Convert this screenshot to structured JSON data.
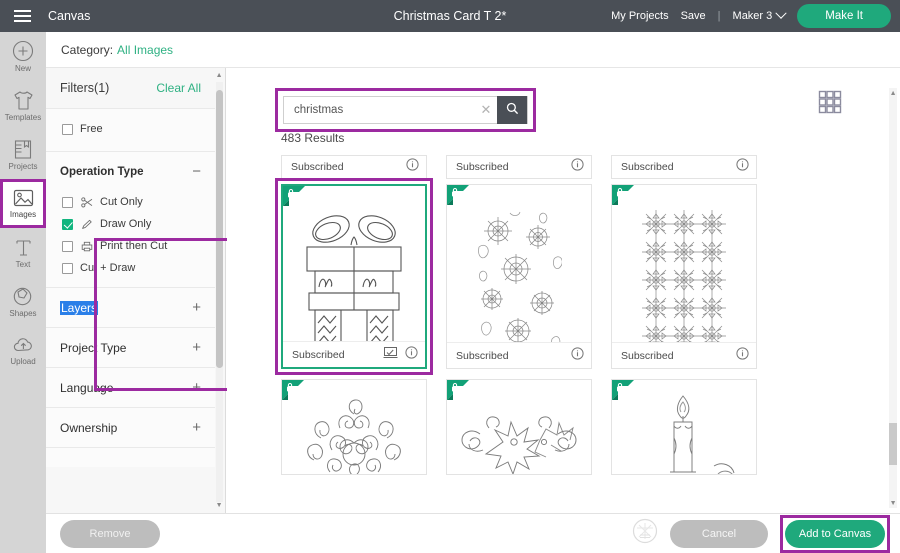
{
  "topbar": {
    "menu_icon": "hamburger-icon",
    "canvas_label": "Canvas",
    "project_title": "Christmas Card T 2*",
    "my_projects_label": "My Projects",
    "save_label": "Save",
    "divider": "|",
    "machine_label": "Maker 3",
    "chevron_icon": "chevron-down-icon",
    "make_it_label": "Make It",
    "bg_color": "#4a4f56",
    "accent_green": "#1fa97c"
  },
  "rail": {
    "items": [
      {
        "label": "New",
        "icon": "plus-circle-icon",
        "selected": false
      },
      {
        "label": "Templates",
        "icon": "tshirt-icon",
        "selected": false
      },
      {
        "label": "Projects",
        "icon": "book-icon",
        "selected": false
      },
      {
        "label": "Images",
        "icon": "image-icon",
        "selected": true
      },
      {
        "label": "Text",
        "icon": "text-icon",
        "selected": false
      },
      {
        "label": "Shapes",
        "icon": "shapes-icon",
        "selected": false
      },
      {
        "label": "Upload",
        "icon": "upload-cloud-icon",
        "selected": false
      }
    ]
  },
  "category_bar": {
    "label": "Category:",
    "value": "All Images"
  },
  "filters": {
    "title": "Filters(1)",
    "clear_all": "Clear All",
    "free_option": {
      "label": "Free",
      "checked": false
    },
    "operation_type": {
      "title": "Operation Type",
      "toggle": "−",
      "expanded": true,
      "highlighted": true,
      "options": [
        {
          "label": "Cut Only",
          "checked": false,
          "icon": "scissors-icon"
        },
        {
          "label": "Draw Only",
          "checked": true,
          "icon": "pen-icon"
        },
        {
          "label": "Print then Cut",
          "checked": false,
          "icon": "printer-icon"
        },
        {
          "label": "Cut + Draw",
          "checked": false,
          "icon": "none"
        }
      ]
    },
    "sections": [
      {
        "title": "Layers",
        "toggle": "+",
        "text_selected": true
      },
      {
        "title": "Project Type",
        "toggle": "+",
        "text_selected": false
      },
      {
        "title": "Language",
        "toggle": "+",
        "text_selected": false
      },
      {
        "title": "Ownership",
        "toggle": "+",
        "text_selected": false
      }
    ]
  },
  "search": {
    "value": "christmas",
    "placeholder": "Search",
    "clear_icon": "close-icon",
    "search_icon": "search-icon",
    "highlighted": true
  },
  "results": {
    "count_label": "483 Results",
    "grid_toggle_icon": "grid-view-icon",
    "cards": [
      {
        "top_label": "Subscribed",
        "foot_label": "Subscribed",
        "art": "gift-box",
        "selected": true,
        "badge": "lock-icon",
        "has_draw_icon": true
      },
      {
        "top_label": "Subscribed",
        "foot_label": "Subscribed",
        "art": "snowflake-pattern",
        "selected": false,
        "badge": "lock-icon",
        "has_draw_icon": false
      },
      {
        "top_label": "Subscribed",
        "foot_label": "Subscribed",
        "art": "geometric-pattern",
        "selected": false,
        "badge": "lock-icon",
        "has_draw_icon": false
      },
      {
        "top_label": "",
        "foot_label": "",
        "art": "swirl-mandala",
        "selected": false,
        "badge": "lock-icon",
        "has_draw_icon": false
      },
      {
        "top_label": "",
        "foot_label": "",
        "art": "poinsettia-flourish",
        "selected": false,
        "badge": "lock-icon",
        "has_draw_icon": false
      },
      {
        "top_label": "",
        "foot_label": "",
        "art": "candle",
        "selected": false,
        "badge": "lock-icon",
        "has_draw_icon": false
      }
    ],
    "info_icon": "info-icon"
  },
  "footer": {
    "remove_label": "Remove",
    "mat_icon": "cricut-mat-icon",
    "cancel_label": "Cancel",
    "add_label": "Add to Canvas",
    "add_highlighted": true
  }
}
